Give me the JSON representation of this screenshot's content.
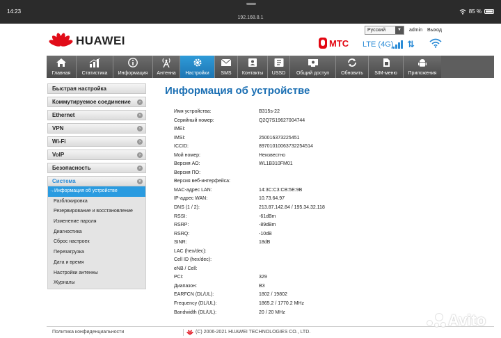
{
  "status_bar": {
    "time": "14:23",
    "url": "192.168.8.1",
    "battery": "85 %"
  },
  "header": {
    "brand": "HUAWEI",
    "language": "Русский",
    "user": "admin",
    "logout": "Выход",
    "operator": "МТС",
    "network": "LTE (4G)"
  },
  "nav": {
    "items": [
      {
        "label": "Главная",
        "icon": "home-icon"
      },
      {
        "label": "Статистика",
        "icon": "statistics-icon"
      },
      {
        "label": "Информация",
        "icon": "info-icon"
      },
      {
        "label": "Антенна",
        "icon": "antenna-icon"
      },
      {
        "label": "Настройки",
        "icon": "settings-icon",
        "active": true
      },
      {
        "label": "SMS",
        "icon": "envelope-icon"
      },
      {
        "label": "Контакты",
        "icon": "contacts-icon"
      },
      {
        "label": "USSD",
        "icon": "ussd-icon"
      },
      {
        "label": "Общий доступ",
        "icon": "share-icon"
      },
      {
        "label": "Обновить",
        "icon": "update-icon"
      },
      {
        "label": "SIM-меню",
        "icon": "sim-menu-icon"
      },
      {
        "label": "Приложения",
        "icon": "apps-icon"
      }
    ]
  },
  "sidebar": {
    "items": [
      {
        "label": "Быстрая настройка",
        "arrow": false
      },
      {
        "label": "Коммутируемое соединение",
        "arrow": true
      },
      {
        "label": "Ethernet",
        "arrow": true
      },
      {
        "label": "VPN",
        "arrow": true
      },
      {
        "label": "Wi-Fi",
        "arrow": true
      },
      {
        "label": "VoIP",
        "arrow": true
      },
      {
        "label": "Безопасность",
        "arrow": true
      },
      {
        "label": "Система",
        "arrow": true,
        "open": true
      }
    ],
    "sub_items": [
      "Информация об устройстве",
      "Разблокировка",
      "Резервирование и восстановление",
      "Изменение пароля",
      "Диагностика",
      "Сброс настроек",
      "Перезагрузка",
      "Дата и время",
      "Настройки антенны",
      "Журналы"
    ]
  },
  "main": {
    "title": "Информация об устройстве",
    "rows": [
      {
        "label": "Имя устройства:",
        "value": "B315s-22"
      },
      {
        "label": "Серийный номер:",
        "value": "Q2Q7S19627004744"
      },
      {
        "label": "IMEI:",
        "value": ""
      },
      {
        "label": "IMSI:",
        "value": "250016373225451"
      },
      {
        "label": "ICCID:",
        "value": "89701010063732254514"
      },
      {
        "label": "Мой номер:",
        "value": "Неизвестно"
      },
      {
        "label": "Версия АО:",
        "value": "WL1B310FM01"
      },
      {
        "label": "Версия ПО:",
        "value": ""
      },
      {
        "label": "Версия веб-интерфейса:",
        "value": ""
      },
      {
        "label": "MAC-адрес LAN:",
        "value": "14:3C:C3:CB:5E:9B"
      },
      {
        "label": "IP-адрес WAN:",
        "value": "10.73.64.97"
      },
      {
        "label": "DNS (1 / 2):",
        "value": "213.87.142.84 / 195.34.32.118"
      },
      {
        "label": "RSSI:",
        "value": "-61dBm"
      },
      {
        "label": "RSRP:",
        "value": "-89dBm"
      },
      {
        "label": "RSRQ:",
        "value": "-10dB"
      },
      {
        "label": "SINR:",
        "value": "18dB"
      },
      {
        "label": "LAC (hex/dec):",
        "value": ""
      },
      {
        "label": "Cell ID (hex/dec):",
        "value": ""
      },
      {
        "label": "eNB / Cell:",
        "value": ""
      },
      {
        "label": "PCI:",
        "value": "329"
      },
      {
        "label": "Диапазон:",
        "value": "B3"
      },
      {
        "label": "EARFCN (DL/UL):",
        "value": "1802 / 19802"
      },
      {
        "label": "Frequency (DL/UL):",
        "value": "1865.2 / 1770.2 MHz"
      },
      {
        "label": "Bandwidth (DL/UL):",
        "value": "20 / 20 MHz"
      }
    ]
  },
  "footer": {
    "privacy": "Политика конфиденциальности",
    "copyright": "(C) 2006-2021 HUAWEI TECHNOLOGIES CO., LTD."
  },
  "watermark": "Avito",
  "colors": {
    "accent": "#2a8bd6",
    "brand_red": "#e10c18",
    "mts_red": "#e30611",
    "nav_active": "#2f9bd8"
  }
}
